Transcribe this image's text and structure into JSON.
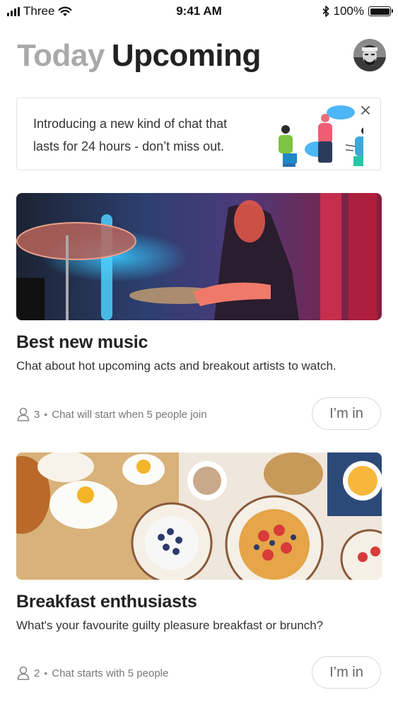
{
  "status_bar": {
    "carrier": "Three",
    "time": "9:41 AM",
    "battery": "100%",
    "battery_level": 1.0
  },
  "header": {
    "tab_today": "Today",
    "tab_upcoming": "Upcoming"
  },
  "banner": {
    "line1": "Introducing a new kind of chat that",
    "line2": "lasts for 24 hours - don’t miss out.",
    "close_icon": "close-icon"
  },
  "cards": [
    {
      "title": "Best new music",
      "description": "Chat about hot upcoming acts and breakout artists to watch.",
      "count": "3",
      "status": "Chat will start when 5 people join",
      "button": "I’m in",
      "image": "drummer-concert-photo"
    },
    {
      "title": "Breakfast enthusiasts",
      "description": "What's your favourite guilty pleasure breakfast or brunch?",
      "count": "2",
      "status": "Chat starts with 5 people",
      "button": "I’m in",
      "image": "breakfast-table-photo"
    }
  ],
  "colors": {
    "accent_text": "#222222",
    "muted_tab": "#a9a9a9",
    "meta": "#777777"
  }
}
